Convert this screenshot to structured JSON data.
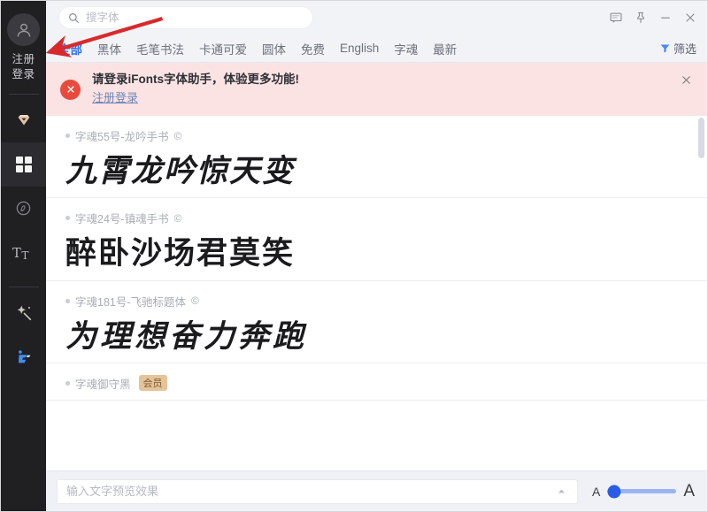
{
  "window": {
    "controls": [
      {
        "name": "feedback-icon",
        "label": "feedback"
      },
      {
        "name": "pin-icon",
        "label": "pin"
      },
      {
        "name": "minimize-icon",
        "label": "minimize"
      },
      {
        "name": "close-icon",
        "label": "close"
      }
    ]
  },
  "rail": {
    "avatar_icon": "user-avatar-icon",
    "register_label": "注册",
    "login_label": "登录",
    "items": [
      {
        "icon": "diamond-vip-icon",
        "label": "VIP",
        "active": false
      },
      {
        "icon": "grid-icon",
        "label": "字体库",
        "active": true
      },
      {
        "icon": "circle-badge-icon",
        "label": "已安装",
        "active": false
      },
      {
        "icon": "tt-text-icon",
        "label": "文字工具",
        "active": false
      },
      {
        "icon": "magic-wand-icon",
        "label": "特效",
        "active": false
      },
      {
        "icon": "ifonts-logo-icon",
        "label": "iFonts",
        "active": false
      }
    ]
  },
  "search": {
    "placeholder": "搜字体",
    "value": "",
    "icon": "search-icon"
  },
  "tabs": [
    {
      "label": "全部",
      "active": true
    },
    {
      "label": "黑体",
      "active": false
    },
    {
      "label": "毛笔书法",
      "active": false
    },
    {
      "label": "卡通可爱",
      "active": false
    },
    {
      "label": "圆体",
      "active": false
    },
    {
      "label": "免费",
      "active": false
    },
    {
      "label": "English",
      "active": false
    },
    {
      "label": "字魂",
      "active": false
    },
    {
      "label": "最新",
      "active": false
    }
  ],
  "filter": {
    "label": "筛选",
    "icon": "funnel-icon"
  },
  "banner": {
    "icon": "error-circle-icon",
    "title": "请登录iFonts字体助手，体验更多功能!",
    "link": "注册登录",
    "close_icon": "close-icon"
  },
  "fonts": [
    {
      "name": "字魂55号-龙吟手书",
      "copyright": "©",
      "sample": "九霄龙吟惊天变",
      "style": "sample-brush",
      "vip": ""
    },
    {
      "name": "字魂24号-镇魂手书",
      "copyright": "©",
      "sample": "醉卧沙场君莫笑",
      "style": "sample-brush2",
      "vip": ""
    },
    {
      "name": "字魂181号-飞驰标题体",
      "copyright": "©",
      "sample": "为理想奋力奔跑",
      "style": "sample-bold",
      "vip": ""
    },
    {
      "name": "字魂御守黑",
      "copyright": "",
      "sample": "",
      "style": "sample-bold",
      "vip": "会员"
    }
  ],
  "bottom": {
    "preview_placeholder": "输入文字预览效果",
    "preview_value": "",
    "collapse_icon": "chevron-up-icon",
    "size_small_label": "A",
    "size_large_label": "A",
    "slider_value": 10
  },
  "colors": {
    "accent": "#2d6df6",
    "rail_bg": "#201f22",
    "banner_bg": "#fbe3e4",
    "banner_icon": "#e84b3d",
    "slider_track": "#9db4f2",
    "slider_thumb": "#2b5ce6",
    "annotation_arrow": "#d9292b"
  }
}
